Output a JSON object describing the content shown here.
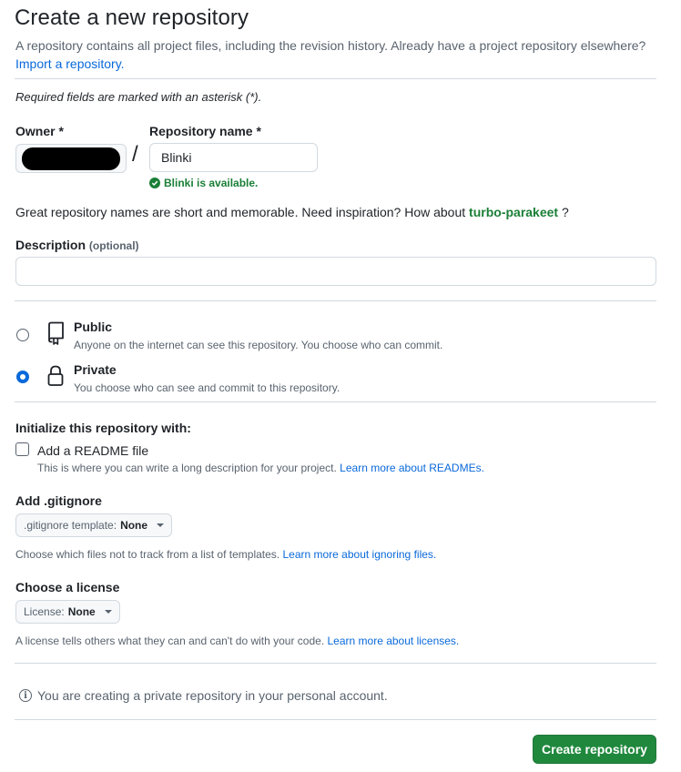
{
  "header": {
    "title": "Create a new repository",
    "subtitle": "A repository contains all project files, including the revision history. Already have a project repository elsewhere?",
    "import_link": "Import a repository."
  },
  "required_note": "Required fields are marked with an asterisk (*).",
  "owner": {
    "label": "Owner *"
  },
  "separator": "/",
  "repo_name": {
    "label": "Repository name *",
    "value": "Blinki",
    "availability": "Blinki is available."
  },
  "inspiration": {
    "text": "Great repository names are short and memorable. Need inspiration? How about",
    "suggestion": "turbo-parakeet",
    "end": "?"
  },
  "description": {
    "label": "Description",
    "optional": "(optional)",
    "value": ""
  },
  "visibility": [
    {
      "title": "Public",
      "desc": "Anyone on the internet can see this repository. You choose who can commit.",
      "icon": "repo-icon",
      "selected": false
    },
    {
      "title": "Private",
      "desc": "You choose who can see and commit to this repository.",
      "icon": "lock-icon",
      "selected": true
    }
  ],
  "initialize": {
    "heading": "Initialize this repository with:",
    "readme_label": "Add a README file",
    "readme_desc": "This is where you can write a long description for your project.",
    "readme_link": "Learn more about READMEs.",
    "readme_checked": false
  },
  "gitignore": {
    "label": "Add .gitignore",
    "select_prefix": ".gitignore template:",
    "select_value": "None",
    "desc": "Choose which files not to track from a list of templates.",
    "link": "Learn more about ignoring files."
  },
  "license": {
    "label": "Choose a license",
    "select_prefix": "License:",
    "select_value": "None",
    "desc": "A license tells others what they can and can't do with your code.",
    "link": "Learn more about licenses."
  },
  "info_note": "You are creating a private repository in your personal account.",
  "create_button": "Create repository",
  "colors": {
    "accent": "#0969da",
    "success": "#1a7f37",
    "primary_button": "#1f883d"
  }
}
